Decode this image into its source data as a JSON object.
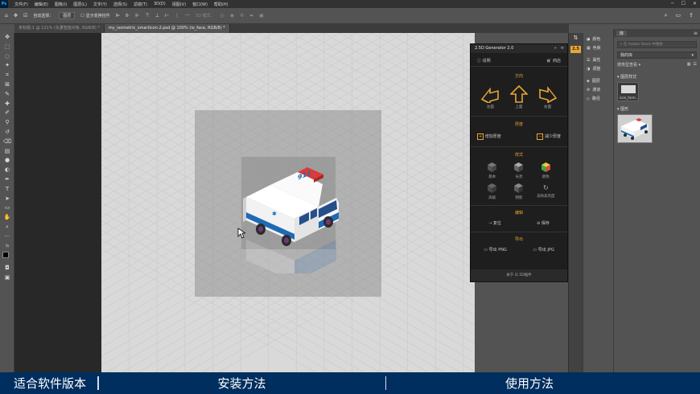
{
  "menubar": {
    "logo": "Ps",
    "items": [
      "文件(F)",
      "编辑(E)",
      "图像(I)",
      "图层(L)",
      "文字(Y)",
      "选择(S)",
      "滤镜(T)",
      "3D(D)",
      "视图(V)",
      "窗口(W)",
      "帮助(H)"
    ]
  },
  "optbar": {
    "auto_select_label": "自动选择：",
    "auto_select_value": "图层",
    "show_transform": "显示变换控件",
    "mode3d": "3D 模式："
  },
  "tabs": [
    {
      "label": "未标题-1 @ 121% (矢量智能对象, RGB/8) *"
    },
    {
      "label": "my_isometric_smarticon-2.psd @ 100% (io_face, RGB/8) *"
    }
  ],
  "plugin": {
    "title": "2.5D Generator 2.0",
    "help": "说明",
    "store": "商店",
    "direction": "方向",
    "dirs": [
      "左面",
      "上面",
      "右面"
    ],
    "thickness": "厚度",
    "thick_add": "增加厚度",
    "thick_sub": "减少厚度",
    "style": "样式",
    "styles": [
      "基本",
      "光亮",
      "颜色",
      "高级",
      "阴影",
      "去除高亮度"
    ],
    "edit": "编辑",
    "reset": "复位",
    "save": "保存",
    "export": "导出",
    "export_png": "导出 PNG",
    "export_jpg": "导出 JPG",
    "footer": "关于 I2.5D插件",
    "badge": "2.5"
  },
  "panels": [
    "颜色",
    "色板",
    "属性",
    "调整",
    "图层",
    "通道",
    "路径"
  ],
  "library": {
    "tab": "库",
    "search_placeholder": "在 Adobe Stock 中搜索",
    "dropdown": "我的库",
    "filter": "按类型查看",
    "sec1": "图层样式",
    "style_name": "icon_form...",
    "sec2": "图形"
  },
  "banner": {
    "items": [
      "适合软件版本",
      "安装方法",
      "使用方法"
    ]
  },
  "colors": {
    "orange": "#e8a534",
    "banner": "#002e5f"
  }
}
